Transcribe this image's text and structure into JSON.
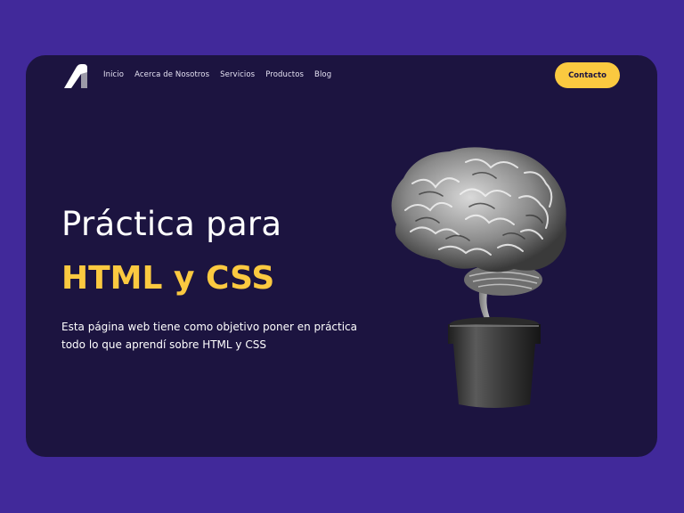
{
  "nav": {
    "items": [
      {
        "label": "Inicio"
      },
      {
        "label": "Acerca de Nosotros"
      },
      {
        "label": "Servicios"
      },
      {
        "label": "Productos"
      },
      {
        "label": "Blog"
      }
    ],
    "contact_label": "Contacto"
  },
  "hero": {
    "title_line1": "Práctica para",
    "title_line2": "HTML y CSS",
    "description": "Esta página web tiene como objetivo poner en práctica todo lo que aprendí sobre HTML y CSS"
  },
  "colors": {
    "background": "#41299a",
    "card": "#1c1440",
    "accent": "#fbc940",
    "text": "#ffffff"
  },
  "icons": {
    "logo": "logo-icon",
    "illustration": "brain-in-pot-illustration"
  }
}
